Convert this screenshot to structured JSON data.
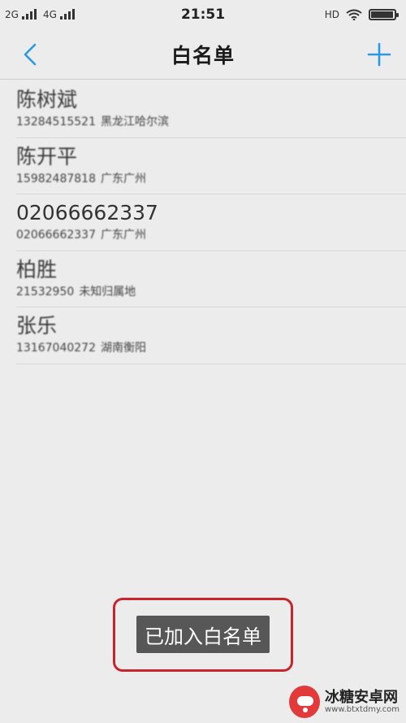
{
  "status_bar": {
    "network_1": "2G",
    "network_2": "4G",
    "time": "21:51",
    "hd_label": "HD"
  },
  "nav": {
    "title": "白名单",
    "back_icon": "chevron-left-icon",
    "add_icon": "plus-icon"
  },
  "contacts": [
    {
      "name": "陈树斌",
      "phone": "13284515521",
      "location": "黑龙江哈尔滨"
    },
    {
      "name": "陈开平",
      "phone": "15982487818",
      "location": "广东广州"
    },
    {
      "name": "02066662337",
      "phone": "02066662337",
      "location": "广东广州"
    },
    {
      "name": "柏胜",
      "phone": "21532950",
      "location": "未知归属地"
    },
    {
      "name": "张乐",
      "phone": "13167040272",
      "location": "湖南衡阳"
    }
  ],
  "toast": {
    "message": "已加入白名单"
  },
  "watermark": {
    "title": "冰糖安卓网",
    "url": "www.btxtdmy.com"
  },
  "colors": {
    "accent": "#2a9ae0",
    "highlight_border": "#c8242b",
    "toast_bg": "#575757",
    "background": "#ececec"
  }
}
